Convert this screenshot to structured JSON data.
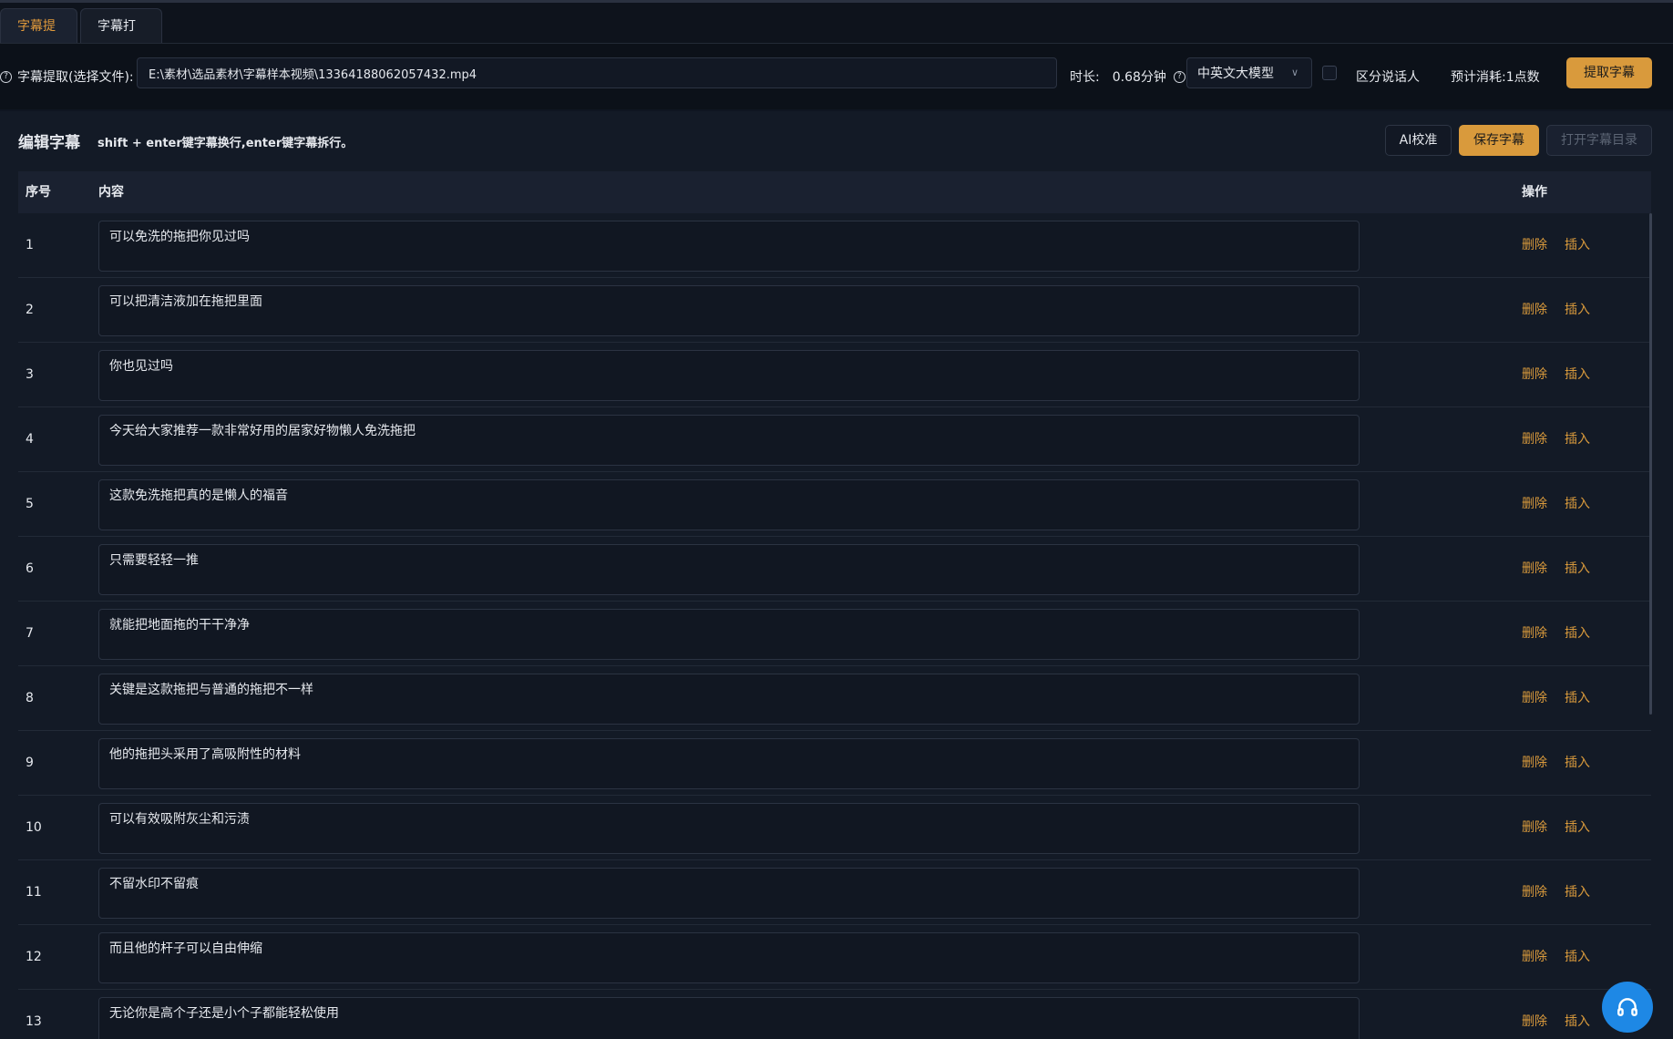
{
  "tabs": [
    {
      "label": "字幕提取",
      "active": true
    },
    {
      "label": "字幕打轴",
      "active": false
    }
  ],
  "toolbar": {
    "file_label": "字幕提取(选择文件):",
    "file_path": "E:\\素材\\选品素材\\字幕样本视频\\13364188062057432.mp4",
    "duration_label": "时长:",
    "duration_value": "0.68分钟",
    "model_value": "中英文大模型",
    "speaker_label": "区分说话人",
    "cost_label": "预计消耗:1点数",
    "extract_button": "提取字幕"
  },
  "editor": {
    "title": "编辑字幕",
    "hint": "shift + enter键字幕换行,enter键字幕拆行。",
    "ai_button": "AI校准",
    "save_button": "保存字幕",
    "open_dir_button": "打开字幕目录"
  },
  "table": {
    "headers": {
      "index": "序号",
      "content": "内容",
      "actions": "操作"
    },
    "delete_label": "删除",
    "insert_label": "插入",
    "rows": [
      {
        "index": "1",
        "text": "可以免洗的拖把你见过吗"
      },
      {
        "index": "2",
        "text": "可以把清洁液加在拖把里面"
      },
      {
        "index": "3",
        "text": "你也见过吗"
      },
      {
        "index": "4",
        "text": "今天给大家推荐一款非常好用的居家好物懒人免洗拖把"
      },
      {
        "index": "5",
        "text": "这款免洗拖把真的是懒人的福音"
      },
      {
        "index": "6",
        "text": "只需要轻轻一推"
      },
      {
        "index": "7",
        "text": "就能把地面拖的干干净净"
      },
      {
        "index": "8",
        "text": "关键是这款拖把与普通的拖把不一样"
      },
      {
        "index": "9",
        "text": "他的拖把头采用了高吸附性的材料"
      },
      {
        "index": "10",
        "text": "可以有效吸附灰尘和污渍"
      },
      {
        "index": "11",
        "text": "不留水印不留痕"
      },
      {
        "index": "12",
        "text": "而且他的杆子可以自由伸缩"
      },
      {
        "index": "13",
        "text": "无论你是高个子还是小个子都能轻松使用"
      }
    ]
  },
  "colors": {
    "accent": "#d99a3c",
    "background": "#131a26",
    "fab": "#1e88e5"
  },
  "icons": {
    "help": "question-circle-icon",
    "dropdown": "chevron-down-icon",
    "fab": "headphones-icon"
  }
}
